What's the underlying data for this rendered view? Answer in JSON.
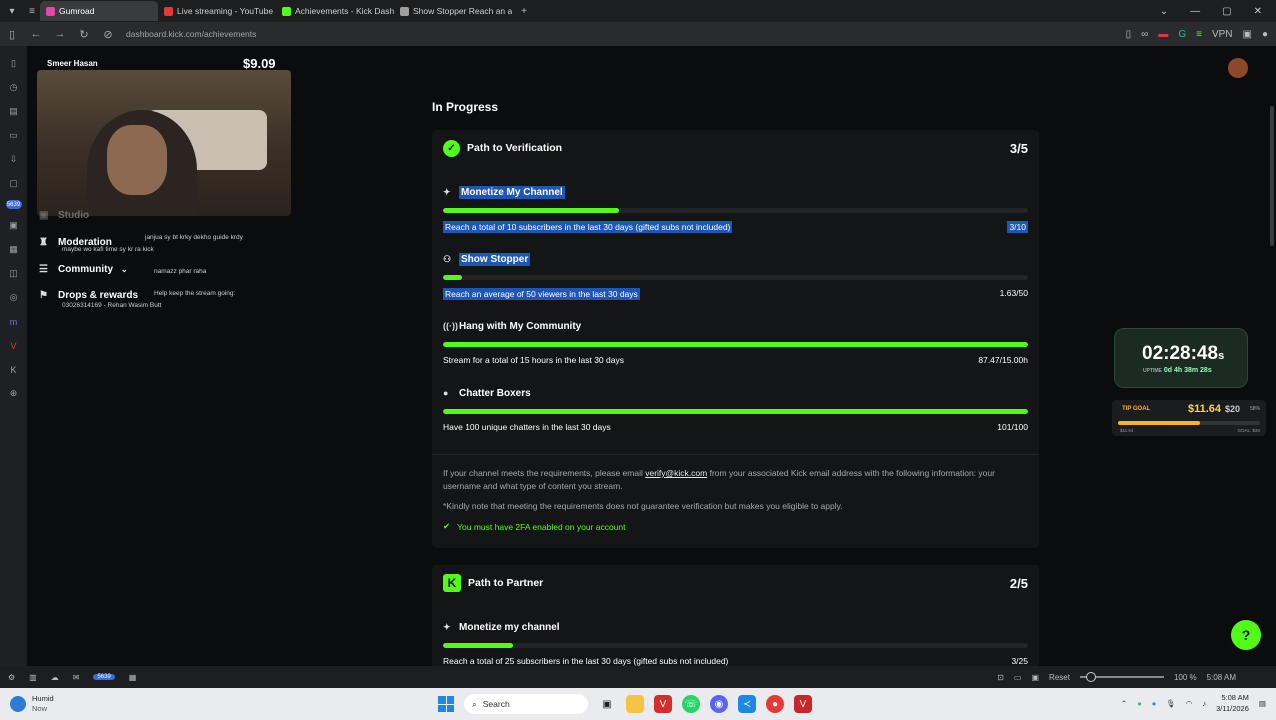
{
  "browser": {
    "tabs": [
      {
        "label": "Gumroad",
        "active": true,
        "color": "#e04aa0"
      },
      {
        "label": "Live streaming - YouTube S",
        "active": false,
        "color": "#e53935"
      },
      {
        "label": "Achievements - Kick Dashb",
        "active": false,
        "color": "#53fc18"
      },
      {
        "label": "Show Stopper Reach an ave",
        "active": false,
        "color": "#9e9e9e"
      }
    ],
    "new_tab": "+",
    "url": "dashboard.kick.com/achievements"
  },
  "stream_overlay": {
    "streamer_text": "Smeer Hasan",
    "money": "$9.09",
    "menu": [
      {
        "label": "Studio"
      },
      {
        "label": "Moderation"
      },
      {
        "label": "Community"
      },
      {
        "label": "Drops & rewards"
      }
    ],
    "chat": [
      "janjua sy bt krky dekho guide krdy",
      "maybe wo kafi time sy kr ra kick",
      "namazz phar raha",
      "Help keep the stream going:",
      "03026314169 - Rehan Wasim Butt"
    ]
  },
  "main": {
    "section_title": "In Progress",
    "verification": {
      "title": "Path to Verification",
      "count": "3/5",
      "achievements": [
        {
          "name": "Monetize My Channel",
          "desc": "Reach a total of 10 subscribers in the last 30 days (gifted subs not included)",
          "value": "3/10",
          "progress": 0.3,
          "icon": "sparkle-icon"
        },
        {
          "name": "Show Stopper",
          "desc": "Reach an average of 50 viewers in the last 30 days",
          "value": "1.63/50",
          "progress": 0.033,
          "icon": "people-icon"
        },
        {
          "name": "Hang with My Community",
          "desc": "Stream for a total of 15 hours in the last 30 days",
          "value": "87.47/15.00h",
          "progress": 1.0,
          "icon": "broadcast-icon"
        },
        {
          "name": "Chatter Boxers",
          "desc": "Have 100 unique chatters in the last 30 days",
          "value": "101/100",
          "progress": 1.0,
          "icon": "chat-icon"
        }
      ],
      "info_pre": "If your channel meets the requirements, please email ",
      "info_email": "verify@kick.com",
      "info_post": " from your associated Kick email address with the following information: your username and what type of content you stream.",
      "note": "*Kindly note that meeting the requirements does not guarantee verification but makes you eligible to apply.",
      "tfa": "You must have 2FA enabled on your account"
    },
    "partner": {
      "title": "Path to Partner",
      "count": "2/5",
      "achievements": [
        {
          "name": "Monetize my channel",
          "desc": "Reach a total of 25 subscribers in the last 30 days (gifted subs not included)",
          "value": "3/25",
          "progress": 0.12
        }
      ]
    }
  },
  "widgets": {
    "timer": "02:28:48",
    "timer_suffix": "s",
    "uptime_label": "UPTIME",
    "uptime": "0d 4h 38m 28s",
    "tip_label": "TIP GOAL",
    "tip_amount": "$11.64",
    "tip_goal": "$20",
    "tip_pct": "58%",
    "tip_progress": 0.58,
    "tip_raised": "$11.64",
    "tip_goal_small": "GOAL: $20"
  },
  "statusbar": {
    "badge": "5639",
    "reset": "Reset",
    "zoom": "100 %",
    "time": "5:08 AM"
  },
  "taskbar": {
    "weather_title": "Humid",
    "weather_sub": "Now",
    "search": "Search",
    "time": "5:08 AM",
    "date": "3/11/2026"
  },
  "rail": {
    "badge": "5639"
  }
}
